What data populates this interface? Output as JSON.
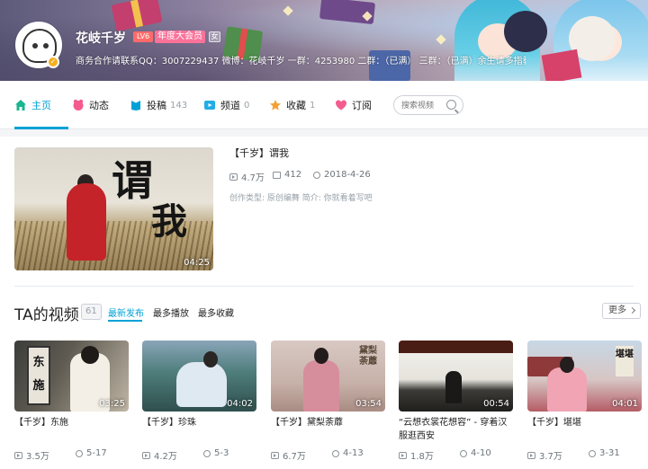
{
  "profile": {
    "username": "花岐千岁",
    "level": "LV6",
    "vip": "年度大会员",
    "gender_icon": "女",
    "sign": "商务合作请联系QQ：3007229437 微博：花岐千岁 一群：4253980 二群：（已满） 三群：（已满）余生请多指教。"
  },
  "nav": {
    "items": [
      {
        "label": "主页",
        "count": "",
        "icon": "home-icon",
        "color": "#00a1d6"
      },
      {
        "label": "动态",
        "count": "",
        "icon": "dynamic-icon",
        "color": "#f45a8d"
      },
      {
        "label": "投稿",
        "count": "143",
        "icon": "upload-icon",
        "color": "#00a1d6"
      },
      {
        "label": "频道",
        "count": "0",
        "icon": "channel-icon",
        "color": "#23ade5"
      },
      {
        "label": "收藏",
        "count": "1",
        "icon": "favorite-icon",
        "color": "#f3a034"
      },
      {
        "label": "订阅",
        "count": "",
        "icon": "subscribe-icon",
        "color": "#f25d8e"
      }
    ],
    "search_placeholder": "搜索视频"
  },
  "featured": {
    "title": "【千岁】谓我",
    "duration": "04:25",
    "plays": "4.7万",
    "danmaku": "412",
    "date": "2018-4-26",
    "desc": "创作类型: 原创编舞 简介: 你就看着写吧",
    "calligraphy": [
      "谓",
      "我"
    ]
  },
  "videos_section": {
    "title": "TA的视频",
    "count": "61",
    "tabs": [
      "最新发布",
      "最多播放",
      "最多收藏"
    ],
    "more": "更多"
  },
  "videos": [
    {
      "title": "【千岁】东施",
      "duration": "03:25",
      "plays": "3.5万",
      "date": "5-17",
      "overlay": "东施"
    },
    {
      "title": "【千岁】珍珠",
      "duration": "04:02",
      "plays": "4.2万",
      "date": "5-3",
      "overlay": ""
    },
    {
      "title": "【千岁】黛梨荼蘼",
      "duration": "03:54",
      "plays": "6.7万",
      "date": "4-13",
      "overlay": "黛梨荼蘼"
    },
    {
      "title": "“云想衣裳花想容” - 穿着汉服逛西安",
      "duration": "00:54",
      "plays": "1.8万",
      "date": "4-10",
      "overlay": ""
    },
    {
      "title": "【千岁】堪堪",
      "duration": "04:01",
      "plays": "3.7万",
      "date": "3-31",
      "overlay": "堪堪"
    }
  ]
}
